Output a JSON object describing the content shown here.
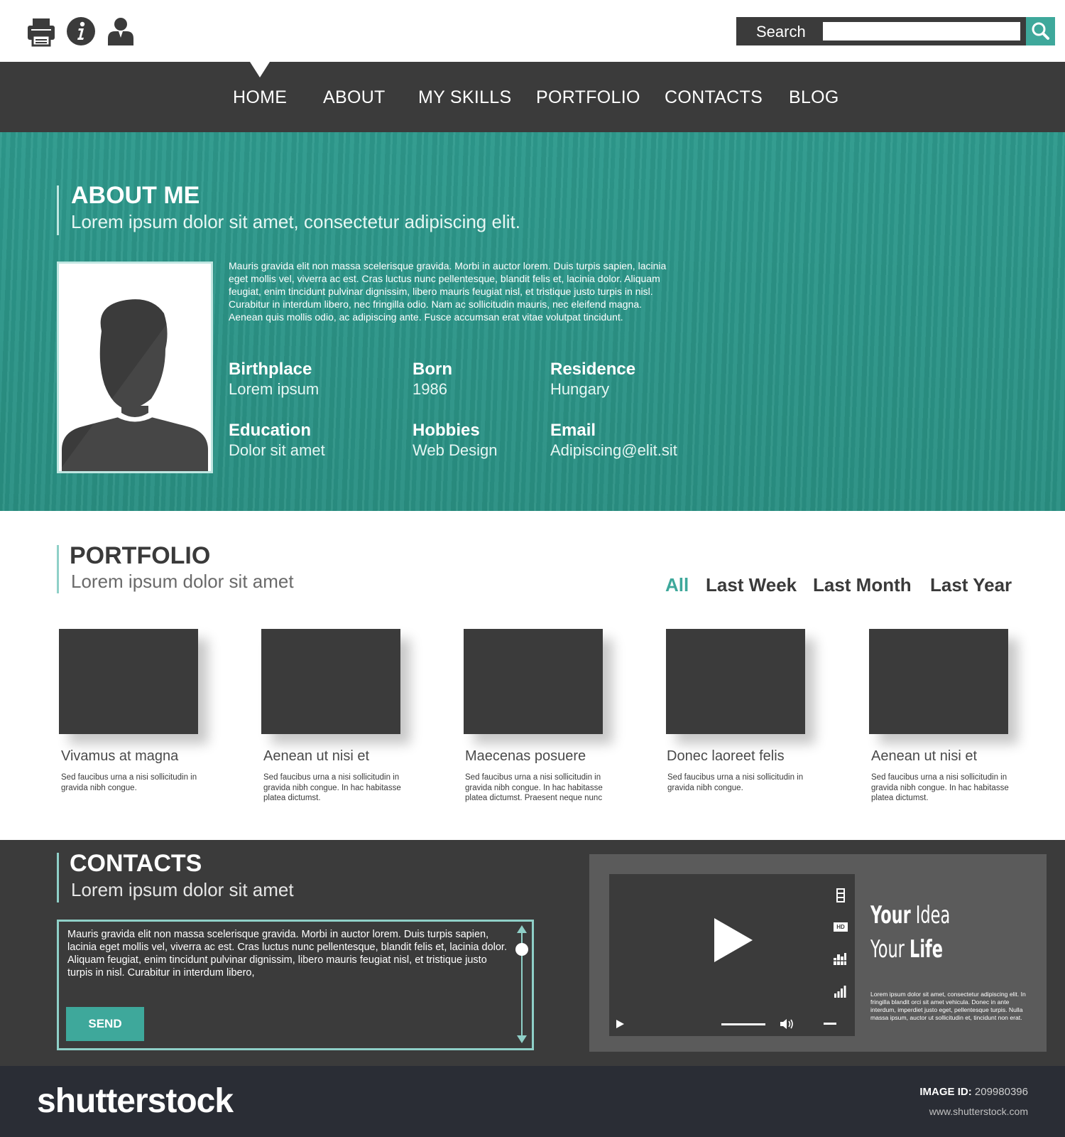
{
  "toolbar": {
    "icons": [
      "printer-icon",
      "info-icon",
      "user-icon"
    ]
  },
  "search": {
    "label": "Search",
    "value": "",
    "placeholder": ""
  },
  "nav": {
    "items": [
      "HOME",
      "ABOUT",
      "MY SKILLS",
      "PORTFOLIO",
      "CONTACTS",
      "BLOG"
    ],
    "active": "HOME"
  },
  "about": {
    "title": "ABOUT ME",
    "subtitle": "Lorem ipsum dolor sit amet, consectetur adipiscing elit.",
    "text": "Mauris gravida elit non massa scelerisque gravida. Morbi in auctor lorem. Duis turpis sapien, lacinia eget mollis vel, viverra ac est. Cras luctus nunc pellentesque, blandit felis et, lacinia dolor. Aliquam feugiat, enim tincidunt pulvinar dignissim, libero mauris feugiat nisl, et tristique justo turpis in nisl. Curabitur in interdum libero, nec fringilla odio. Nam ac sollicitudin mauris, nec eleifend magna. Aenean quis mollis odio, ac adipiscing ante. Fusce accumsan erat vitae volutpat tincidunt.",
    "facts": [
      {
        "label": "Birthplace",
        "value": "Lorem ipsum"
      },
      {
        "label": "Born",
        "value": "1986"
      },
      {
        "label": "Residence",
        "value": "Hungary"
      },
      {
        "label": "Education",
        "value": "Dolor sit amet"
      },
      {
        "label": "Hobbies",
        "value": "Web Design"
      },
      {
        "label": "Email",
        "value": "Adipiscing@elit.sit"
      }
    ]
  },
  "portfolio": {
    "title": "PORTFOLIO",
    "subtitle": "Lorem ipsum dolor sit amet",
    "filters": [
      "All",
      "Last Week",
      "Last Month",
      "Last Year"
    ],
    "active_filter": "All",
    "items": [
      {
        "title": "Vivamus at magna",
        "text": "Sed faucibus urna a nisi sollicitudin in gravida nibh congue."
      },
      {
        "title": "Aenean ut nisi et",
        "text": "Sed faucibus urna a nisi sollicitudin in gravida nibh congue. In hac habitasse platea dictumst."
      },
      {
        "title": "Maecenas posuere",
        "text": "Sed faucibus urna a nisi sollicitudin in gravida nibh congue. In hac habitasse platea dictumst. Praesent neque nunc"
      },
      {
        "title": "Donec laoreet felis",
        "text": "Sed faucibus urna a nisi sollicitudin in gravida nibh congue."
      },
      {
        "title": "Aenean ut nisi et",
        "text": "Sed faucibus urna a nisi sollicitudin in gravida nibh congue. In hac habitasse platea dictumst."
      }
    ]
  },
  "contacts": {
    "title": "CONTACTS",
    "subtitle": "Lorem ipsum dolor sit amet",
    "message": "Mauris gravida elit non massa scelerisque gravida. Morbi in auctor lorem. Duis turpis sapien, lacinia eget mollis vel, viverra ac est. Cras luctus nunc pellentesque, blandit felis et, lacinia dolor. Aliquam feugiat, enim tincidunt pulvinar dignissim, libero mauris feugiat nisl, et tristique justo turpis in nisl. Curabitur in interdum libero,",
    "send_label": "SEND"
  },
  "video": {
    "heading_line1_bold": "Your",
    "heading_line1_light": "Idea",
    "heading_line2_light": "Your",
    "heading_line2_bold": "Life",
    "text": "Lorem ipsum dolor sit amet, consectetur adipiscing elit. In fringilla blandit orci sit amet vehicula. Donec in ante interdum, imperdiet justo eget, pellentesque turpis. Nulla massa ipsum, auctor ut sollicitudin et, tincidunt non erat.",
    "hd_label": "HD",
    "volume_level": 0.6
  },
  "footer": {
    "logo": "shutterstock",
    "image_id_label": "IMAGE ID:",
    "image_id": "209980396",
    "site": "www.shutterstock.com"
  },
  "colors": {
    "accent": "#3ea89b",
    "dark": "#3b3b3b",
    "teal_bg": "#2e9a8d",
    "footer": "#2a2d35"
  }
}
